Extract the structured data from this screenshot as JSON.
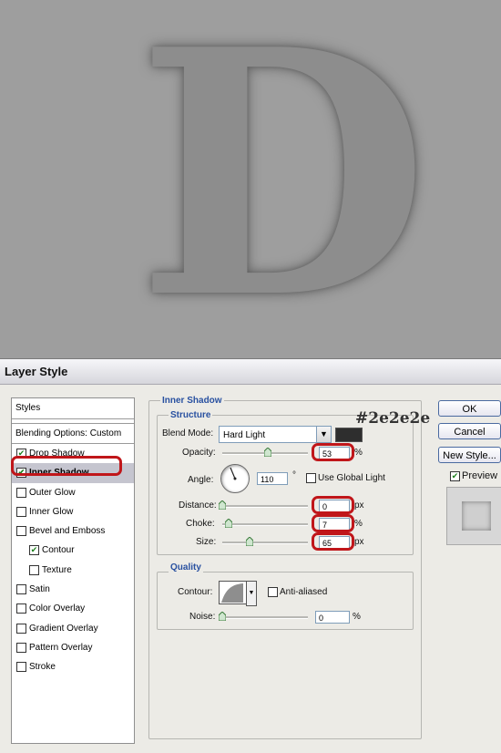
{
  "canvas": {
    "letter": "D"
  },
  "dialog": {
    "title": "Layer Style",
    "styles_panel": {
      "header": "Styles",
      "blending_options": "Blending Options: Custom",
      "items": [
        {
          "label": "Drop Shadow",
          "checked": true,
          "selected": false,
          "sub": false
        },
        {
          "label": "Inner Shadow",
          "checked": true,
          "selected": true,
          "sub": false
        },
        {
          "label": "Outer Glow",
          "checked": false,
          "selected": false,
          "sub": false
        },
        {
          "label": "Inner Glow",
          "checked": false,
          "selected": false,
          "sub": false
        },
        {
          "label": "Bevel and Emboss",
          "checked": false,
          "selected": false,
          "sub": false
        },
        {
          "label": "Contour",
          "checked": true,
          "selected": false,
          "sub": true
        },
        {
          "label": "Texture",
          "checked": false,
          "selected": false,
          "sub": true
        },
        {
          "label": "Satin",
          "checked": false,
          "selected": false,
          "sub": false
        },
        {
          "label": "Color Overlay",
          "checked": false,
          "selected": false,
          "sub": false
        },
        {
          "label": "Gradient Overlay",
          "checked": false,
          "selected": false,
          "sub": false
        },
        {
          "label": "Pattern Overlay",
          "checked": false,
          "selected": false,
          "sub": false
        },
        {
          "label": "Stroke",
          "checked": false,
          "selected": false,
          "sub": false
        }
      ]
    },
    "inner_shadow": {
      "section_title": "Inner Shadow",
      "structure_title": "Structure",
      "blend_mode_label": "Blend Mode:",
      "blend_mode_value": "Hard Light",
      "color": "#2e2e2e",
      "color_annotation": "#2e2e2e",
      "opacity_label": "Opacity:",
      "opacity_value": "53",
      "opacity_unit": "%",
      "angle_label": "Angle:",
      "angle_value": "110",
      "angle_unit": "°",
      "use_global_light_label": "Use Global Light",
      "use_global_light_checked": false,
      "distance_label": "Distance:",
      "distance_value": "0",
      "distance_unit": "px",
      "choke_label": "Choke:",
      "choke_value": "7",
      "choke_unit": "%",
      "size_label": "Size:",
      "size_value": "65",
      "size_unit": "px",
      "quality_title": "Quality",
      "contour_label": "Contour:",
      "anti_aliased_label": "Anti-aliased",
      "anti_aliased_checked": false,
      "noise_label": "Noise:",
      "noise_value": "0",
      "noise_unit": "%"
    },
    "buttons": {
      "ok": "OK",
      "cancel": "Cancel",
      "new_style": "New Style...",
      "preview_label": "Preview",
      "preview_checked": true
    },
    "highlight_color": "#c0161a"
  }
}
